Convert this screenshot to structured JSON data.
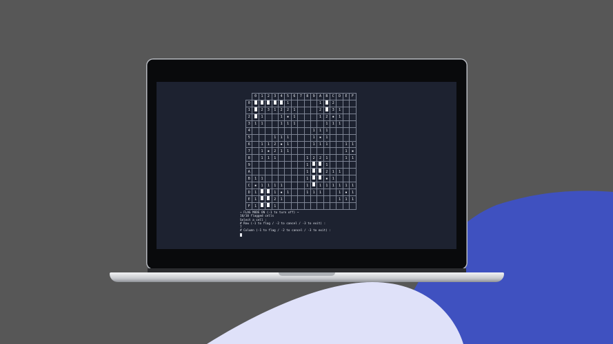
{
  "colors": {
    "background": "#575757",
    "accent_blue": "#3f51c0",
    "accent_light": "#dfe1f9",
    "screen": "#1d2230",
    "text": "#e6e8ee"
  },
  "board": {
    "column_headers": [
      "",
      "0",
      "1",
      "2",
      "3",
      "4",
      "5",
      "6",
      "7",
      "8",
      "9",
      "A",
      "B",
      "C",
      "D",
      "E",
      "F"
    ],
    "rows": [
      {
        "label": "0",
        "cells": [
          "■",
          "■",
          "■",
          "■",
          "■",
          "1",
          "",
          "",
          "",
          "",
          "1",
          "■",
          "2",
          "",
          "",
          ""
        ]
      },
      {
        "label": "1",
        "cells": [
          "■",
          "2",
          "3",
          "1",
          "2",
          "2",
          "1",
          "",
          "",
          "",
          "2",
          "■",
          "3",
          "1",
          "",
          ""
        ]
      },
      {
        "label": "2",
        "cells": [
          "■",
          "1",
          "",
          "",
          "1",
          "▪",
          "1",
          "",
          "",
          "",
          "1",
          "2",
          "▪",
          "1",
          "",
          ""
        ]
      },
      {
        "label": "3",
        "cells": [
          "1",
          "1",
          "",
          "",
          "1",
          "1",
          "1",
          "",
          "",
          "",
          "",
          "1",
          "1",
          "1",
          "",
          ""
        ]
      },
      {
        "label": "4",
        "cells": [
          "",
          "",
          "",
          "",
          "",
          "",
          "",
          "",
          "",
          "1",
          "1",
          "1",
          "",
          "",
          "",
          ""
        ]
      },
      {
        "label": "5",
        "cells": [
          "",
          "",
          "",
          "1",
          "1",
          "1",
          "",
          "",
          "",
          "1",
          "▪",
          "1",
          "",
          "",
          "",
          ""
        ]
      },
      {
        "label": "6",
        "cells": [
          "",
          "1",
          "1",
          "2",
          "▪",
          "1",
          "",
          "",
          "",
          "1",
          "1",
          "1",
          "",
          "",
          "1",
          "1"
        ]
      },
      {
        "label": "7",
        "cells": [
          "",
          "1",
          "▪",
          "2",
          "1",
          "1",
          "",
          "",
          "",
          "",
          "",
          "",
          "",
          "",
          "1",
          "▪"
        ]
      },
      {
        "label": "8",
        "cells": [
          "",
          "1",
          "1",
          "1",
          "",
          "",
          "",
          "",
          "1",
          "2",
          "2",
          "1",
          "",
          "",
          "1",
          "1"
        ]
      },
      {
        "label": "9",
        "cells": [
          "",
          "",
          "",
          "",
          "",
          "",
          "",
          "",
          "1",
          "■",
          "■",
          "1",
          "",
          "",
          "",
          ""
        ]
      },
      {
        "label": "A",
        "cells": [
          "",
          "",
          "",
          "",
          "",
          "",
          "",
          "",
          "1",
          "■",
          "■",
          "2",
          "1",
          "1",
          "",
          ""
        ]
      },
      {
        "label": "B",
        "cells": [
          "1",
          "1",
          "",
          "",
          "",
          "",
          "",
          "",
          "1",
          "■",
          "■",
          "▪",
          "1",
          "",
          "",
          ""
        ]
      },
      {
        "label": "C",
        "cells": [
          "▪",
          "1",
          "1",
          "1",
          "1",
          "",
          "",
          "",
          "1",
          "■",
          "1",
          "1",
          "1",
          "1",
          "1",
          "1"
        ]
      },
      {
        "label": "D",
        "cells": [
          "1",
          "■",
          "■",
          "1",
          "▪",
          "1",
          "",
          "",
          "1",
          "1",
          "1",
          "",
          "",
          "1",
          "▪",
          "1"
        ]
      },
      {
        "label": "E",
        "cells": [
          "1",
          "■",
          "■",
          "2",
          "1",
          "",
          "",
          "",
          "",
          "",
          "",
          "",
          "",
          "1",
          "1",
          "1"
        ]
      },
      {
        "label": "F",
        "cells": [
          "1",
          "■",
          "■",
          "1",
          "",
          "",
          "",
          "",
          "",
          "",
          "",
          "",
          "",
          "",
          "",
          ""
        ]
      }
    ]
  },
  "terminal": {
    "line1": "~ FLAG MODE ON (-1 to turn off) ~",
    "line2": "10/10 flagged cells",
    "line3": "Select a cell :",
    "line4": "",
    "line5": "# Row (-1 to flag / -2 to cancel / -3 to exit) :",
    "line6": "7",
    "line7": "",
    "line8": "# Column (-1 to flag / -2 to cancel / -3 to exit) :"
  }
}
